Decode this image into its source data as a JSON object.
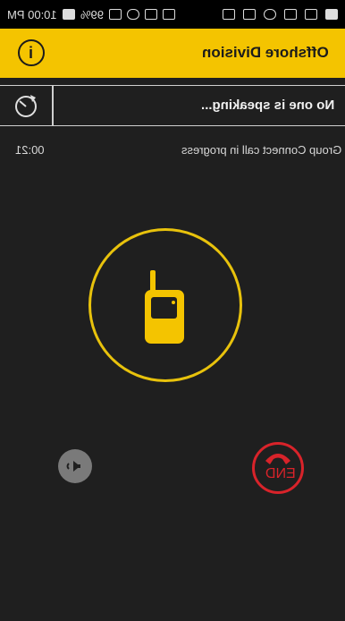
{
  "status_bar": {
    "time": "10:00 PM",
    "battery": "99%"
  },
  "header": {
    "title": "Offshore Division",
    "info_icon": "info-icon"
  },
  "speaker_bar": {
    "text": "No one is speaking...",
    "refresh_icon": "refresh-icon"
  },
  "call": {
    "status": "Group Connect call in progress",
    "timer": "00:21"
  },
  "controls": {
    "end_label": "END",
    "speaker_icon": "speaker-icon"
  },
  "colors": {
    "accent": "#f4c400",
    "ring": "#e8c20c",
    "end": "#d8232a",
    "background": "#1f1f1f"
  }
}
